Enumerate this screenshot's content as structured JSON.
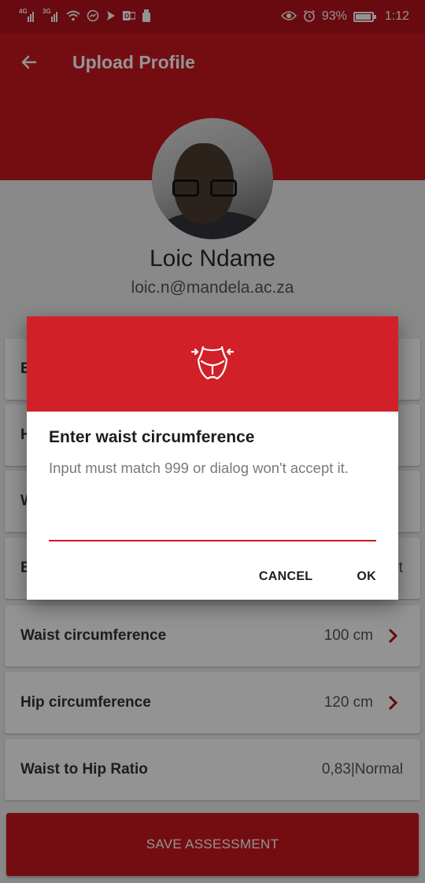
{
  "status_bar": {
    "network_1": "4G",
    "network_2": "3G",
    "battery": "93%",
    "time": "1:12",
    "icons": [
      "signal-icon",
      "wifi-icon",
      "messenger-icon",
      "send-icon",
      "outlook-icon",
      "usb-icon",
      "eye-icon",
      "alarm-icon",
      "battery-icon"
    ]
  },
  "appbar": {
    "title": "Upload Profile",
    "back_icon": "arrow-left-icon"
  },
  "profile": {
    "name": "Loic Ndame",
    "email": "loic.n@mandela.ac.za"
  },
  "rows": [
    {
      "label": "Waist circumference",
      "value": "100 cm",
      "icon": "chevron-right-icon"
    },
    {
      "label": "Hip circumference",
      "value": "120 cm",
      "icon": "chevron-right-icon"
    },
    {
      "label": "Waist to Hip Ratio",
      "value": "0,83|Normal"
    }
  ],
  "partial_rows": [
    "B",
    "H",
    "W",
    "B"
  ],
  "partial_row_value_tail": "t",
  "save_button": {
    "label": "SAVE ASSESSMENT"
  },
  "dialog": {
    "icon": "waist-measure-icon",
    "title": "Enter waist circumference",
    "message": "Input must match 999 or dialog won't accept it.",
    "input_value": "",
    "cancel_label": "CANCEL",
    "ok_label": "OK"
  },
  "colors": {
    "primary": "#c8181f",
    "status_bar": "#b3121b",
    "dialog_header": "#d12028",
    "chevron": "#b01016"
  }
}
